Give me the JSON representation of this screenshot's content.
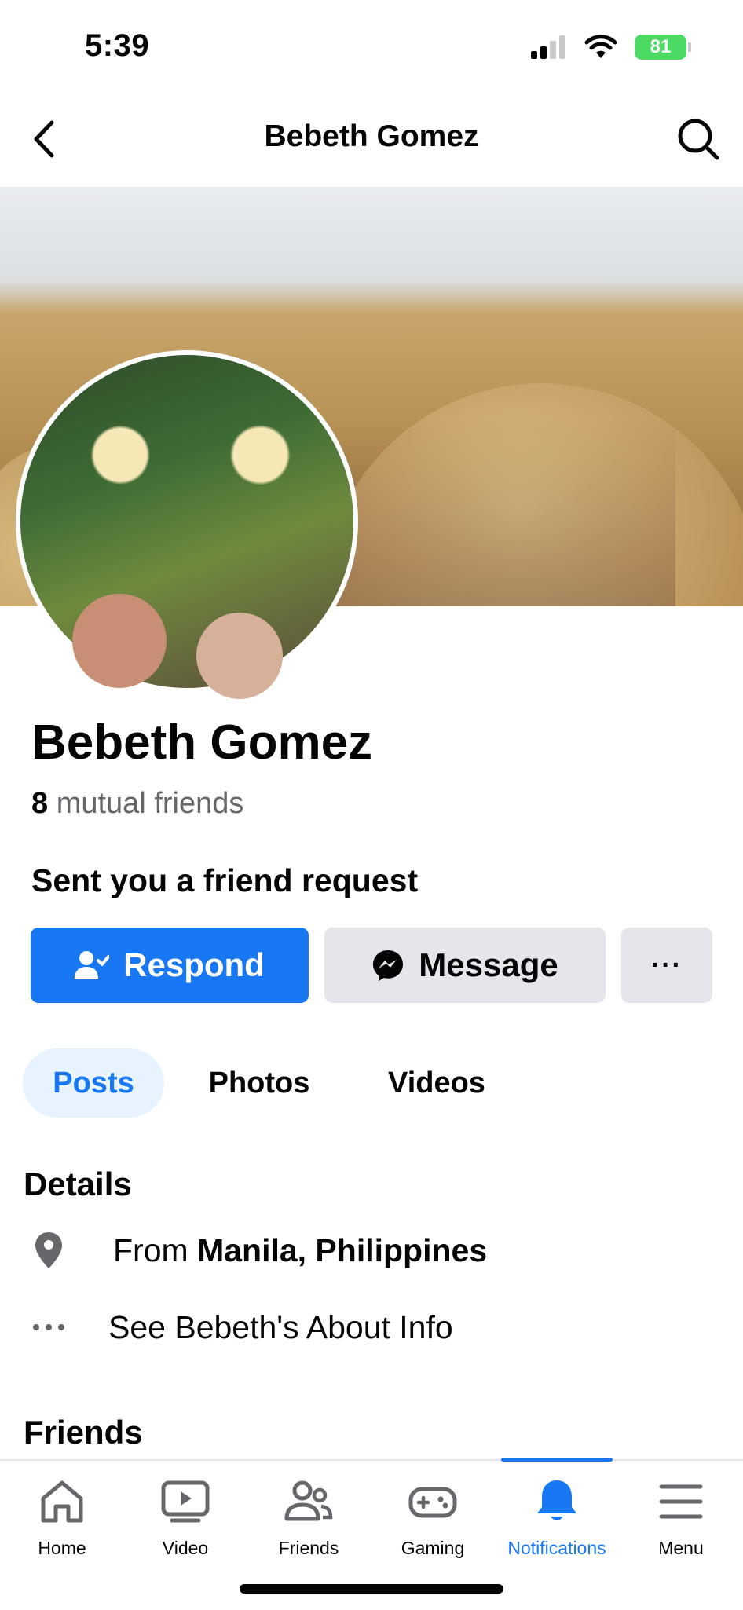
{
  "status_bar": {
    "time": "5:39",
    "battery": "81"
  },
  "nav": {
    "title": "Bebeth Gomez"
  },
  "profile": {
    "name": "Bebeth Gomez",
    "mutual_count": "8",
    "mutual_label": "mutual friends",
    "request_label": "Sent you a friend request"
  },
  "actions": {
    "respond": "Respond",
    "message": "Message",
    "more": "···"
  },
  "tabs": [
    {
      "label": "Posts",
      "active": true
    },
    {
      "label": "Photos",
      "active": false
    },
    {
      "label": "Videos",
      "active": false
    }
  ],
  "details": {
    "heading": "Details",
    "from_prefix": "From",
    "from_place": "Manila, Philippines",
    "about": "See Bebeth's About Info"
  },
  "friends_heading": "Friends",
  "tabbar": [
    {
      "label": "Home",
      "icon": "home-icon"
    },
    {
      "label": "Video",
      "icon": "video-icon"
    },
    {
      "label": "Friends",
      "icon": "friends-icon"
    },
    {
      "label": "Gaming",
      "icon": "gaming-icon"
    },
    {
      "label": "Notifications",
      "icon": "bell-icon",
      "active": true
    },
    {
      "label": "Menu",
      "icon": "menu-icon"
    }
  ],
  "colors": {
    "accent": "#1877f2",
    "accent_light": "#e7f3ff",
    "button_gray": "#e4e6eb",
    "secondary_text": "#65676b",
    "battery_green": "#4cd964"
  }
}
